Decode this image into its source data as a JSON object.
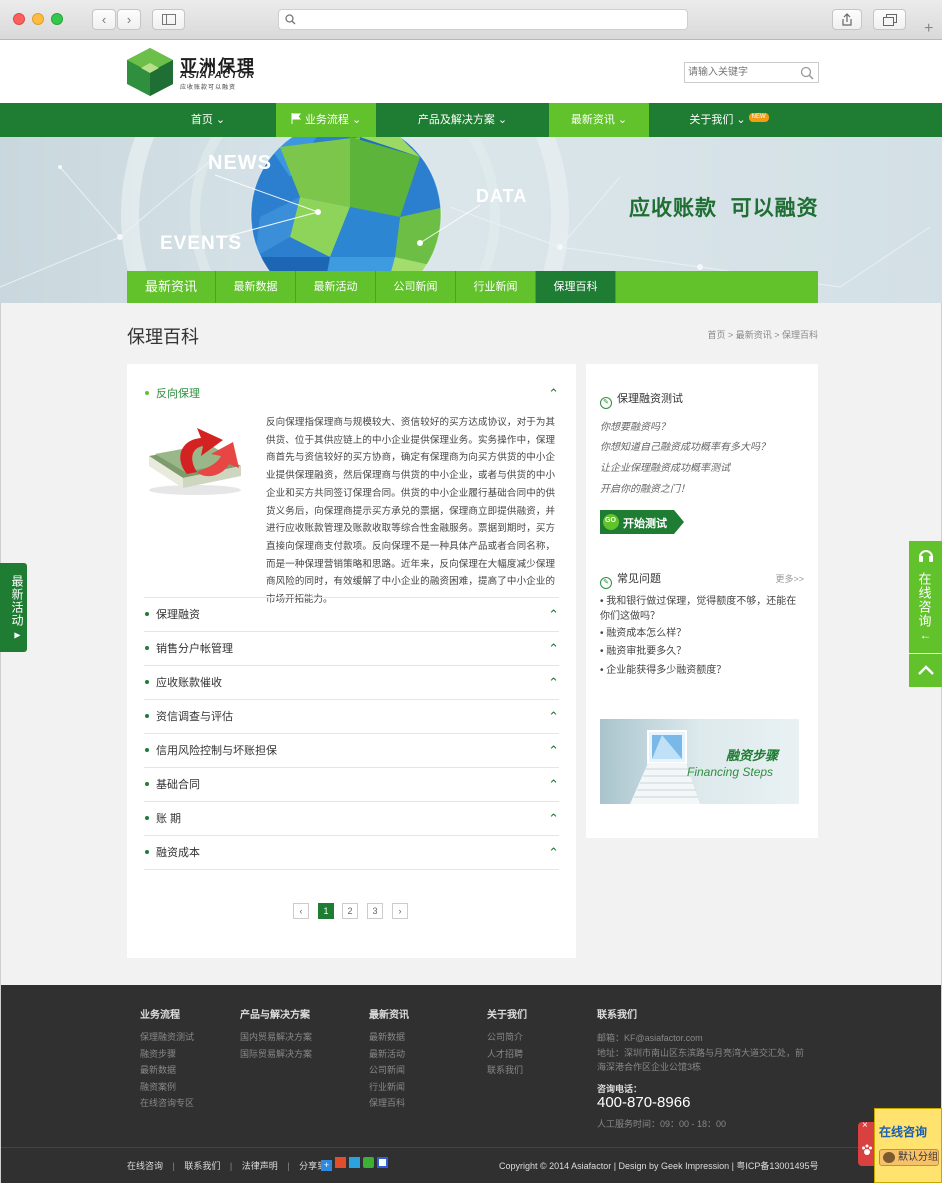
{
  "header": {
    "logo_cn": "亚洲保理",
    "logo_en": "ASIAFACTOR",
    "logo_sub": "应收账款可以融资",
    "search_placeholder": "请输入关键字"
  },
  "nav": {
    "items": [
      {
        "label": "首页"
      },
      {
        "label": "业务流程"
      },
      {
        "label": "产品及解决方案"
      },
      {
        "label": "最新资讯"
      },
      {
        "label": "关于我们",
        "badge": "NEW"
      }
    ]
  },
  "banner": {
    "news": "NEWS",
    "data": "DATA",
    "events": "EVENTS",
    "slogan": "应收账款  可以融资"
  },
  "subnav": {
    "items": [
      "最新资讯",
      "最新数据",
      "最新活动",
      "公司新闻",
      "行业新闻",
      "保理百科"
    ],
    "active": "保理百科"
  },
  "page": {
    "title": "保理百科",
    "breadcrumb": "首页 > 最新资讯 > 保理百科"
  },
  "accordion": {
    "open_title": "反向保理",
    "open_body": "反向保理指保理商与规模较大、资信较好的买方达成协议，对于为其供货、位于其供应链上的中小企业提供保理业务。实务操作中，保理商首先与资信较好的买方协商，确定有保理商为向买方供货的中小企业提供保理融资，然后保理商与供货的中小企业，或者与供货的中小企业和买方共同签订保理合同。供货的中小企业履行基础合同中的供货义务后，向保理商提示买方承兑的票据，保理商立即提供融资，并进行应收账款管理及账款收取等综合性金融服务。票据到期时，买方直接向保理商支付款项。反向保理不是一种具体产品或者合同名称，而是一种保理营销策略和思路。近年来，反向保理在大幅度减少保理商风险的同时，有效缓解了中小企业的融资困难，提高了中小企业的市场开拓能力。",
    "items": [
      "保理融资",
      "销售分户帐管理",
      "应收账款催收",
      "资信调查与评估",
      "信用风险控制与坏账担保",
      "基础合同",
      "账 期",
      "融资成本"
    ]
  },
  "pagination": {
    "pages": [
      "1",
      "2",
      "3"
    ],
    "current": "1"
  },
  "sidebar": {
    "test_title": "保理融资测试",
    "questions": [
      "你想要融资吗？",
      "你想知道自己融资成功概率有多大吗？",
      "让企业保理融资成功概率测试",
      "开启你的融资之门！"
    ],
    "go_label": "GO",
    "start_label": "开始测试",
    "faq_title": "常见问题",
    "faq_more": "更多>>",
    "faq": [
      "我和银行做过保理，觉得额度不够，还能在你们这做吗？",
      "融资成本怎么样？",
      "融资审批要多久？",
      "企业能获得多少融资额度？"
    ],
    "steps_cn": "融资步骤",
    "steps_en": "Financing Steps"
  },
  "footer": {
    "cols": [
      {
        "title": "业务流程",
        "items": [
          "保理融资测试",
          "融资步骤",
          "最新数据",
          "融资案例",
          "在线咨询专区"
        ]
      },
      {
        "title": "产品与解决方案",
        "items": [
          "国内贸易解决方案",
          "国际贸易解决方案"
        ]
      },
      {
        "title": "最新资讯",
        "items": [
          "最新数据",
          "最新活动",
          "公司新闻",
          "行业新闻",
          "保理百科"
        ]
      },
      {
        "title": "关于我们",
        "items": [
          "公司简介",
          "人才招聘",
          "联系我们"
        ]
      }
    ],
    "contact_title": "联系我们",
    "email": "邮箱：KF@asiafactor.com",
    "address": "地址：深圳市南山区东滨路与月亮湾大道交汇处，前海深港合作区企业公馆3栋",
    "phone_label": "咨询电话：",
    "phone": "400-870-8966",
    "hours": "人工服务时间：09：00 - 18：00",
    "links": [
      "在线咨询",
      "联系我们",
      "法律声明"
    ],
    "share_label": "分享到：",
    "copyright": "Copyright © 2014 Asiafactor | Design by Geek Impression | 粤ICP备13001495号"
  },
  "float": {
    "left_tab": "最新活动",
    "right_tab": "在线咨询",
    "chat_title": "在线咨询",
    "chat_sub": "默认分组"
  },
  "colors": {
    "dark_green": "#1f7c33",
    "light_green": "#62c22c"
  }
}
